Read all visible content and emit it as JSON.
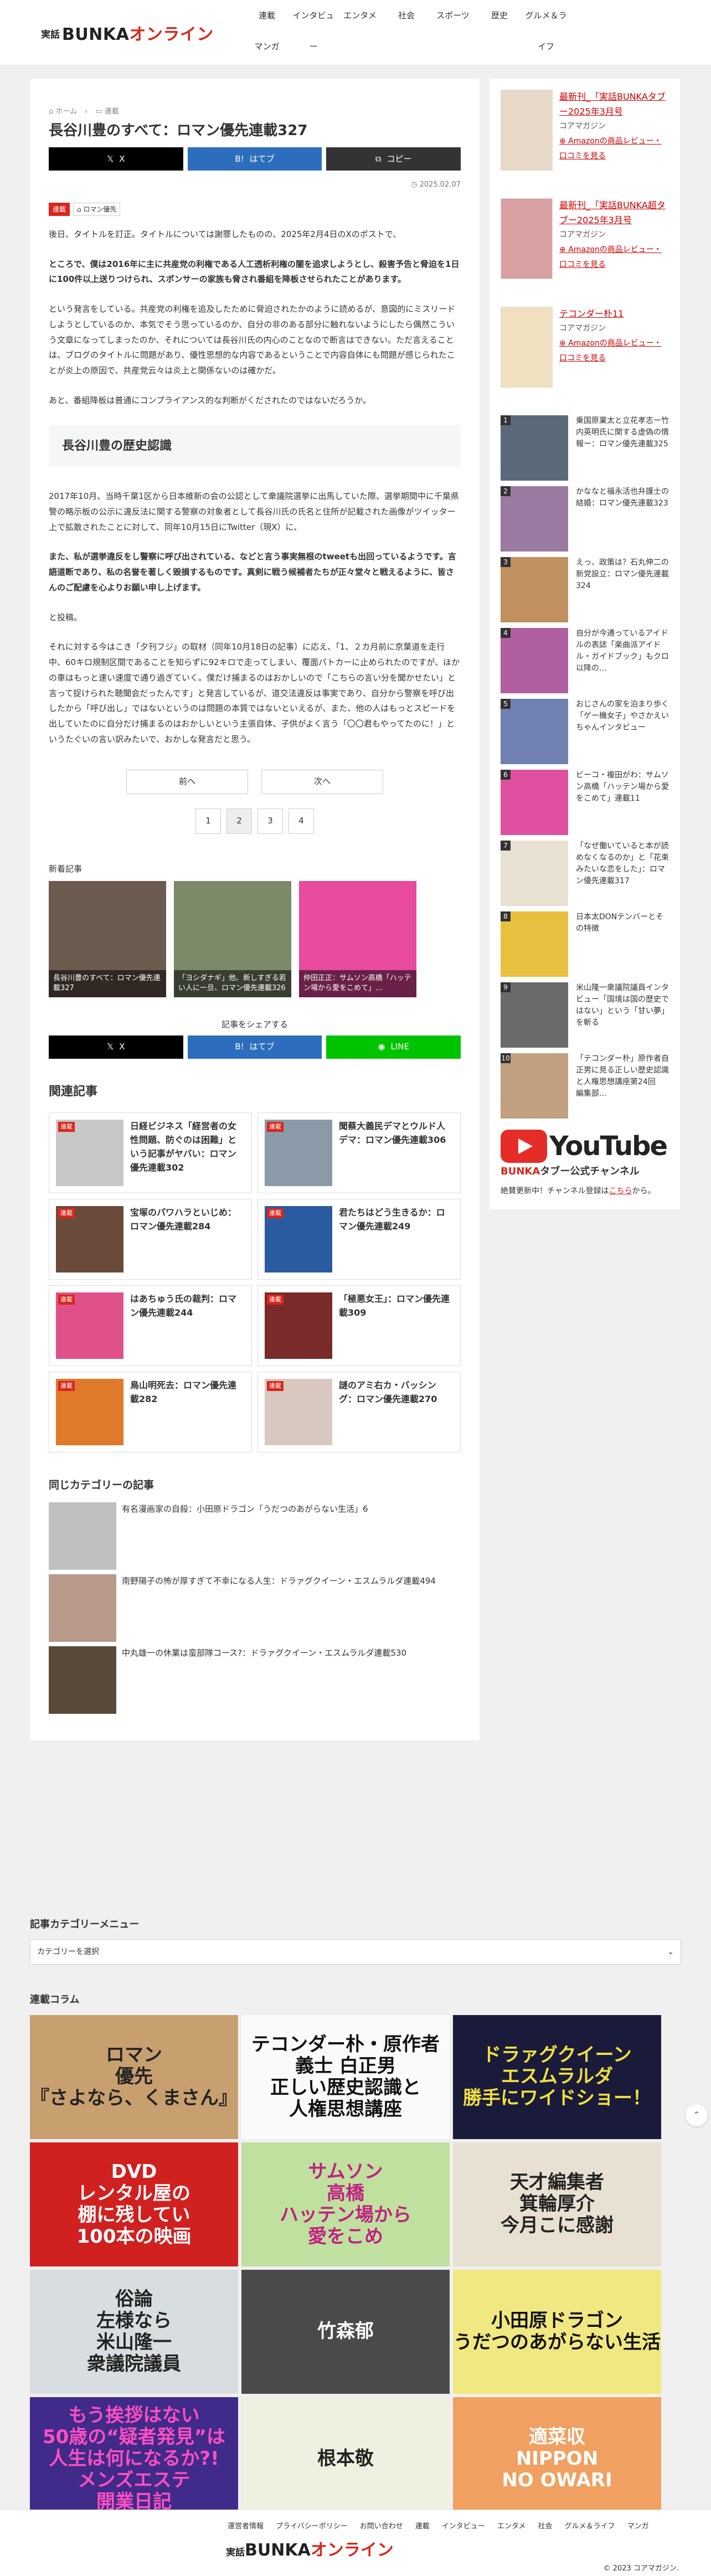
{
  "header": {
    "logo_small": "実話",
    "logo_main": "BUNKA",
    "logo_accent": "オンライン",
    "nav": [
      "連載",
      "インタビュー",
      "エンタメ",
      "社会",
      "スポーツ",
      "歴史",
      "グルメ＆ライフ",
      "マンガ"
    ]
  },
  "article": {
    "breadcrumb": [
      "⌂ ホーム",
      "›",
      "▭ 連載"
    ],
    "title": "長谷川豊のすべて：ロマン優先連載327",
    "share": {
      "x": "X",
      "hatena": "はてブ",
      "copy": "コピー",
      "line": "LINE"
    },
    "date": "2025.02.07",
    "tags": [
      "連載",
      "ロマン優先"
    ],
    "paragraphs": [
      {
        "text": "後日、タイトルを訂正。タイトルについては謝罪したものの、2025年2月4日のXのポストで、",
        "bold": false
      },
      {
        "text": "ところで、僕は2016年に主に共産党の利権である人工透析利権の闇を追求しようとし、殺害予告と脅迫を1日に100件以上送りつけられ、スポンサーの家族も脅され番組を降板させられたことがあります。",
        "bold": true
      },
      {
        "text": "という発言をしている。共産党の利権を追及したために脅迫されたかのように読めるが、意図的にミスリードしようとしているのか、本気でそう思っているのか、自分の非のある部分に触れないようにしたら偶然こういう文章になってしまったのか、それについては長谷川氏の内心のことなので断言はできない。ただ言えることは、ブログのタイトルに問題があり、優性思想的な内容であるということで内容自体にも問題が感じられたことが炎上の原因で、共産党云々は炎上と関係ないのは確かだ。",
        "bold": false
      },
      {
        "text": "あと、番組降板は普通にコンプライアンス的な判断がくだされたのではないだろうか。",
        "bold": false
      }
    ],
    "h2": "長谷川豊の歴史認識",
    "paragraphs2": [
      {
        "text": "2017年10月、当時千葉1区から日本維新の会の公認として衆議院選挙に出馬していた際、選挙期間中に千葉県警の略示板の公示に違反法に関する警察の対象者として長谷川氏の氏名と住所が記載された画像がツイッター上で拡散されたことに対して、同年10月15日にTwitter（現X）に、",
        "bold": false
      },
      {
        "text": "また、私が選挙違反をし警察に呼び出されている、などと言う事実無根のtweetも出回っているようです。言語道断であり、私の名誉を著しく毀損するものです。真剣に戦う候補者たちが正々堂々と戦えるように、皆さんのご配慮を心よりお願い申し上げます。",
        "bold": true
      },
      {
        "text": "と投稿。",
        "bold": false
      },
      {
        "text": "それに対する今はこき「夕刊フジ」の取材（同年10月18日の記事）に応え、「1、２カ月前に京葉道を走行中、60キロ規制区間であることを知らずに92キロで走ってしまい、覆面パトカーに止められたのですが、ほかの車はもっと速い速度で通り過ぎていく。僕だけ捕まるのはおかしいので「こちらの言い分を聞かせたい」と言って捉けられた聴聞会だったんです」と発言しているが、道交法違反は事実であり、自分から警察を呼び出したから「呼び出し」ではないというのは問題の本質ではないといえるが、また、他の人はもっとスピードを出していたのに自分だけ捕まるのはおかしいという主張自体、子供がよく言う「〇〇君もやってたのに！」というたぐいの言い訳みたいで、おかしな発言だと思う。",
        "bold": false
      }
    ],
    "pager": {
      "prev": "前へ",
      "next": "次へ"
    },
    "pages": [
      "1",
      "2",
      "3",
      "4"
    ],
    "new_label": "新着記事",
    "new_cards": [
      {
        "caption": "長谷川豊のすべて：ロマン優先連載327",
        "color": "#6b5a4e"
      },
      {
        "caption": "「ヨシダナギ」他、新しすぎる若い人に一旦、ロマン優先連載326",
        "color": "#7c8a6a"
      },
      {
        "caption": "仲田正正：サムソン高橋「ハッテン場から愛をこめて」…",
        "color": "#e84b9d"
      }
    ],
    "share_label": "記事をシェアする",
    "related_h": "関連記事",
    "related": [
      {
        "title": "日経ビジネス「経営者の女性問題、防ぐのは困難」という記事がヤバい：ロマン優先連載302",
        "color": "#c8c8c8"
      },
      {
        "title": "聞蔡大義民デマとウルド人デマ：ロマン優先連載306",
        "color": "#8a9aa8"
      },
      {
        "title": "宝塚のパワハラといじめ：ロマン優先連載284",
        "color": "#6a4a3a"
      },
      {
        "title": "君たちはどう生きるか：ロマン優先連載249",
        "color": "#2a5aa0"
      },
      {
        "title": "はあちゅう氏の裁判：ロマン優先連載244",
        "color": "#e0508a"
      },
      {
        "title": "「極悪女王」：ロマン優先連載309",
        "color": "#7a2a2a"
      },
      {
        "title": "鳥山明死去：ロマン優先連載282",
        "color": "#e07a2a"
      },
      {
        "title": "謎のアミ右カ・バッシング：ロマン優先連載270",
        "color": "#d8c8c0"
      }
    ],
    "same_h": "同じカテゴリーの記事",
    "same": [
      {
        "title": "有名漫画家の自殺：小田原ドラゴン「うだつのあがらない生活」6",
        "color": "#c0c0c0"
      },
      {
        "title": "南野陽子の怖が厚すぎて不幸になる人生：ドラァグクイーン・エスムラルダ連載494",
        "color": "#b89a8a"
      },
      {
        "title": "中丸雄一の休業は蛮部隊コース?：ドラァグクイーン・エスムラルダ連載530",
        "color": "#5a4a3a"
      }
    ]
  },
  "sidebar": {
    "promos": [
      {
        "title": "最新刊_「実話BUNKAタブー2025年3月号",
        "publisher": "コアマガジン",
        "link": "Amazonの商品レビュー・口コミを見る",
        "color": "#e8d8c8"
      },
      {
        "title": "最新刊_「実話BUNKA超タブー2025年3月号",
        "publisher": "コアマガジン",
        "link": "Amazonの商品レビュー・口コミを見る",
        "color": "#d8a0a0"
      },
      {
        "title": "テコンダー朴11",
        "publisher": "コアマガジン",
        "link": "Amazonの商品レビュー・口コミを見る",
        "color": "#f0e0c0"
      }
    ],
    "ranking": [
      {
        "no": "1",
        "title": "乗国原業太と立花孝志ー竹内英明氏に関する虚偽の情報ー：ロマン優先連載325",
        "color": "#5a6a7a"
      },
      {
        "no": "2",
        "title": "かななと福永活也弁護士の結婚：ロマン優先連載323",
        "color": "#9a7aa0"
      },
      {
        "no": "3",
        "title": "えっ、政策は？石丸伸二の新党設立：ロマン優先連載324",
        "color": "#c09060"
      },
      {
        "no": "4",
        "title": "自分が今通っているアイドルの表誌「楽曲派アイドル・ガイドブック」もクロ以降の…",
        "color": "#b060a0"
      },
      {
        "no": "5",
        "title": "おじさんの家を泊まり歩く「ゲー機女子」やさかえいちゃんインタビュー",
        "color": "#7080b0"
      },
      {
        "no": "6",
        "title": "ビーコ・複田がわ：サムソン高橋「ハッテン場から愛をこめて」連載11",
        "color": "#e050a0"
      },
      {
        "no": "7",
        "title": "「なぜ働いていると本が読めなくなるのか」と「花束みたいな恋をした」：ロマン優先連載317",
        "color": "#e8e0d0"
      },
      {
        "no": "8",
        "title": "日本太DONテンバーとその特徴",
        "color": "#e8c040"
      },
      {
        "no": "9",
        "title": "米山隆一衆議院議員インタビュー「国境は国の歴史ではない」という「甘い夢」を斬る",
        "color": "#6a6a6a"
      },
      {
        "no": "10",
        "title": "「テコンダー朴」原作者自正男に見る正しい歴史認識と人権思想講座第24回　編集部…",
        "color": "#c0a080"
      }
    ],
    "yt_text": "YouTube",
    "yt_sub_red": "BUNKA",
    "yt_sub_rest": "タブー公式チャンネル",
    "yt_desc": "絶賛更新中！チャンネル登録は",
    "yt_link": "こちら",
    "yt_tail": "から。"
  },
  "lower": {
    "category_h": "記事カテゴリーメニュー",
    "category_select": "カテゴリーを選択",
    "columns_h": "連載コラム",
    "columns": [
      {
        "lines": [
          "ロマン",
          "優先",
          "『さよなら、くまさん』"
        ],
        "bg": "#c8a070",
        "fg": "#222"
      },
      {
        "lines": [
          "テコンダー朴・原作者",
          "義士 白正男",
          "正しい歴史認識と",
          "人権思想講座"
        ],
        "bg": "#fafafa",
        "fg": "#111"
      },
      {
        "lines": [
          "ドラァグクイーン",
          "エスムラルダ",
          "勝手にワイドショー！"
        ],
        "bg": "#1a1a3a",
        "fg": "#f0e040"
      },
      {
        "lines": [
          "DVD",
          "レンタル屋の",
          "棚に残してい",
          "100本の映画"
        ],
        "bg": "#d02020",
        "fg": "#fff"
      },
      {
        "lines": [
          "サムソン",
          "高橋",
          "ハッテン場から",
          "愛をこめ"
        ],
        "bg": "#c0e0a0",
        "fg": "#c02080"
      },
      {
        "lines": [
          "天才編集者",
          "箕輪厚介",
          "今月こに感謝"
        ],
        "bg": "#e8e0d0",
        "fg": "#222"
      },
      {
        "lines": [
          "俗論",
          "左様なら",
          "米山隆一",
          "衆議院議員"
        ],
        "bg": "#d8dde0",
        "fg": "#222"
      },
      {
        "lines": [
          "竹森郁"
        ],
        "bg": "#4a4a4a",
        "fg": "#fff"
      },
      {
        "lines": [
          "小田原ドラゴン",
          "うだつのあがらない生活"
        ],
        "bg": "#f0e880",
        "fg": "#111"
      },
      {
        "lines": [
          "もう挨拶はない",
          "50歳の“疑者発見”は",
          "人生は何になるか?!",
          "メンズエステ",
          "開業日記"
        ],
        "bg": "#402a8a",
        "fg": "#ff4fc0"
      },
      {
        "lines": [
          "根本敬"
        ],
        "bg": "#f0f0e0",
        "fg": "#222"
      },
      {
        "lines": [
          "適菜収",
          "NIPPON",
          "NO OWARI"
        ],
        "bg": "#f0a060",
        "fg": "#fff"
      }
    ]
  },
  "footer": {
    "nav": [
      "運営者情報",
      "プライバシーポリシー",
      "お問い合わせ",
      "連載",
      "インタビュー",
      "エンタメ",
      "社会",
      "グルメ＆ライフ",
      "マンガ"
    ],
    "copyright": "© 2023 コアマガジン."
  }
}
